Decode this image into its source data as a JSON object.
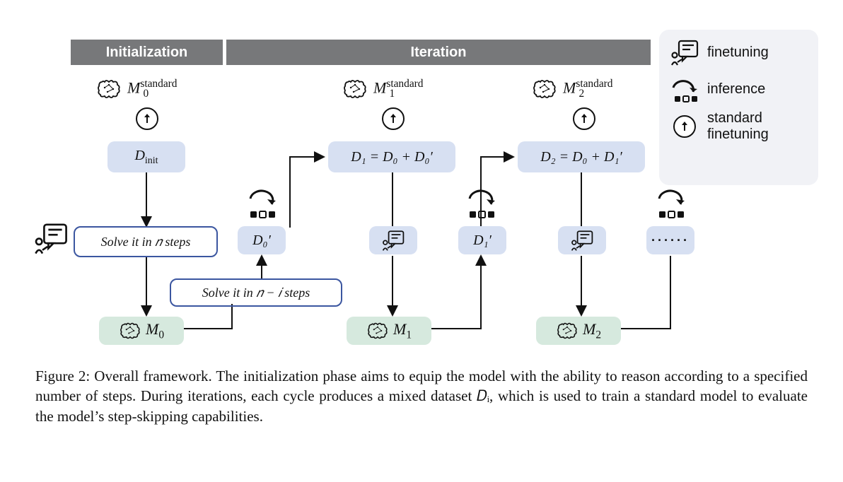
{
  "headers": {
    "initialization": "Initialization",
    "iteration": "Iteration"
  },
  "legend": {
    "finetuning": "finetuning",
    "inference": "inference",
    "standard_finetuning": "standard\nfinetuning"
  },
  "models": {
    "m0_standard_base": "M",
    "m0_standard_sup": "standard",
    "m0_standard_sub": "0",
    "m1_standard_sup": "standard",
    "m1_standard_sub": "1",
    "m2_standard_sup": "standard",
    "m2_standard_sub": "2",
    "m0_sub": "0",
    "m1_sub": "1",
    "m2_sub": "2"
  },
  "datasets": {
    "d_init_base": "D",
    "d_init_sub": "init",
    "d1_expr": "D₁ = D₀ + D₀′",
    "d2_expr": "D₂ = D₀ + D₁′",
    "d0_prime": "D₀′",
    "d1_prime": "D₁′"
  },
  "prompts": {
    "solve_n": "Solve it in 𝑛 steps",
    "solve_nmi": "Solve it in 𝑛 − 𝑖 steps"
  },
  "ellipsis": "······",
  "caption": "Figure 2: Overall framework. The initialization phase aims to equip the model with the ability to reason according to a specified number of steps. During iterations, each cycle produces a mixed dataset 𝐷ᵢ, which is used to train a standard model to evaluate the model’s step-skipping capabilities."
}
